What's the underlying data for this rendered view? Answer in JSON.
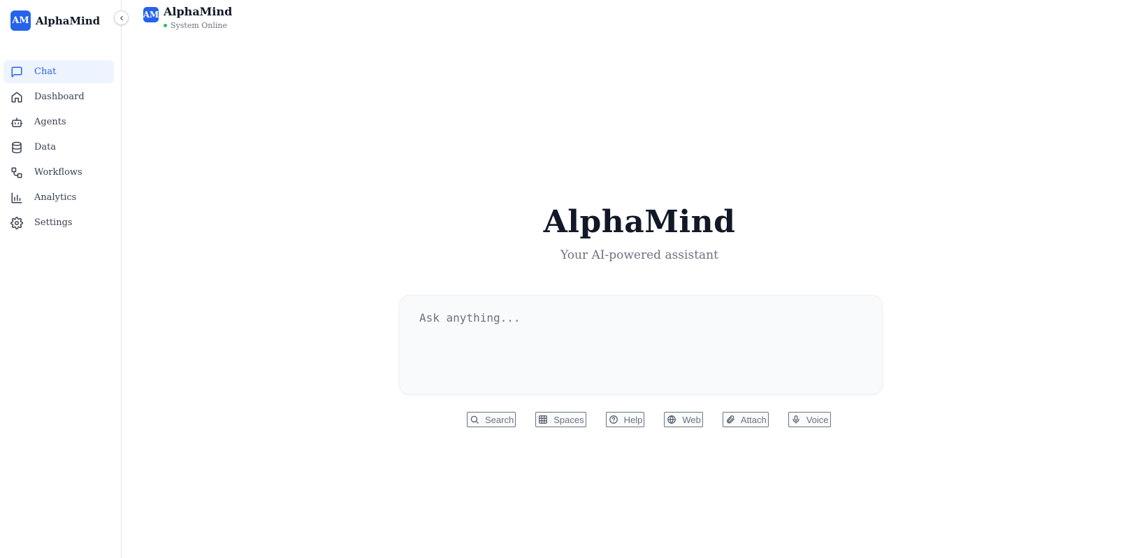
{
  "sidebar": {
    "brand": {
      "logo": "AM",
      "name": "AlphaMind"
    },
    "collapse_icon": "chevron-left-icon",
    "items": [
      {
        "label": "Chat",
        "icon": "message-square-icon",
        "active": true
      },
      {
        "label": "Dashboard",
        "icon": "home-icon",
        "active": false
      },
      {
        "label": "Agents",
        "icon": "bot-icon",
        "active": false
      },
      {
        "label": "Data",
        "icon": "database-icon",
        "active": false
      },
      {
        "label": "Workflows",
        "icon": "workflow-icon",
        "active": false
      },
      {
        "label": "Analytics",
        "icon": "bar-chart-icon",
        "active": false
      },
      {
        "label": "Settings",
        "icon": "gear-icon",
        "active": false
      }
    ]
  },
  "header": {
    "logo": "AM",
    "title": "AlphaMind",
    "status": "System Online",
    "status_color": "#22c55e"
  },
  "main": {
    "title": "AlphaMind",
    "subtitle": "Your AI-powered assistant",
    "prompt_placeholder": "Ask anything...",
    "actions": [
      {
        "label": "Search",
        "icon": "search-icon"
      },
      {
        "label": "Spaces",
        "icon": "grid-icon"
      },
      {
        "label": "Help",
        "icon": "help-circle-icon"
      },
      {
        "label": "Web",
        "icon": "globe-icon"
      },
      {
        "label": "Attach",
        "icon": "paperclip-icon"
      },
      {
        "label": "Voice",
        "icon": "mic-icon"
      }
    ]
  },
  "colors": {
    "accent": "#2563eb",
    "active_bg": "#eef4ff",
    "muted_text": "#6b7280"
  }
}
